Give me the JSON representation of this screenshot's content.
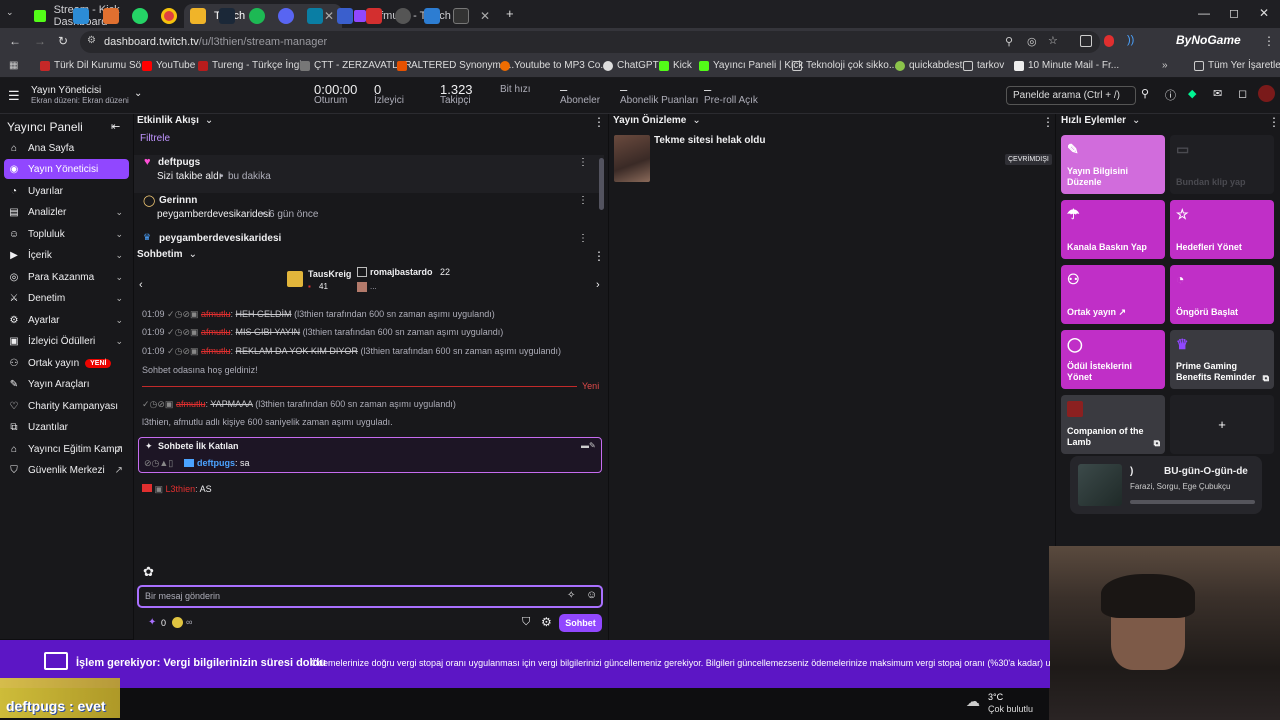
{
  "browser": {
    "tabs": [
      {
        "label": "Stream - Kick Dashboard",
        "color": "#53fc18"
      },
      {
        "label": "Twitch",
        "color": "#9147ff"
      },
      {
        "label": "afmutlu - Twitch",
        "color": "#9147ff"
      }
    ],
    "url_host": "dashboard.twitch.tv",
    "url_path": "/u/l3thien/stream-manager",
    "profile_label": "ByNoGame",
    "bookmarks": [
      "Türk Dil Kurumu Sö...",
      "YouTube",
      "Tureng - Türkçe İngi...",
      "ÇTT - ZERZAVATLAR",
      "ALTERED Synonyms...",
      "Youtube to MP3 Co...",
      "ChatGPT",
      "Kick",
      "Yayıncı Paneli | Kick",
      "Teknoloji çok sikko...",
      "quickabdest",
      "tarkov",
      "10 Minute Mail - Fr..."
    ],
    "bookmarks_all": "Tüm Yer İşaretleri"
  },
  "topbar": {
    "manager_title": "Yayın Yöneticisi",
    "layout_label": "Ekran düzeni: Ekran düzeni 1",
    "stats": [
      {
        "value": "0:00:00",
        "label": "Oturum"
      },
      {
        "value": "0",
        "label": "İzleyici"
      },
      {
        "value": "1.323",
        "label": "Takipçi"
      },
      {
        "value": "",
        "label": "Bit hızı"
      },
      {
        "value": "–",
        "label": "Aboneler"
      },
      {
        "value": "–",
        "label": "Abonelik Puanları"
      },
      {
        "value": "–",
        "label": "Pre-roll Açık"
      }
    ],
    "search_placeholder": "Panelde arama (Ctrl + /)"
  },
  "sidebar": {
    "title": "Yayıncı Paneli",
    "items": [
      {
        "label": "Ana Sayfa",
        "icon": "house-icon",
        "chevron": false
      },
      {
        "label": "Yayın Yöneticisi",
        "icon": "broadcast-icon",
        "chevron": false,
        "active": true
      },
      {
        "label": "Uyarılar",
        "icon": "bell-icon",
        "chevron": false
      },
      {
        "label": "Analizler",
        "icon": "chart-icon",
        "chevron": true
      },
      {
        "label": "Topluluk",
        "icon": "people-icon",
        "chevron": true
      },
      {
        "label": "İçerik",
        "icon": "video-icon",
        "chevron": true
      },
      {
        "label": "Para Kazanma",
        "icon": "coin-icon",
        "chevron": true
      },
      {
        "label": "Denetim",
        "icon": "sword-icon",
        "chevron": true
      },
      {
        "label": "Ayarlar",
        "icon": "gear-icon",
        "chevron": true
      },
      {
        "label": "İzleyici Ödülleri",
        "icon": "gift-icon",
        "chevron": true
      },
      {
        "label": "Ortak yayın",
        "icon": "coop-icon",
        "badge": "YENİ"
      },
      {
        "label": "Yayın Araçları",
        "icon": "tools-icon"
      },
      {
        "label": "Charity Kampanyası",
        "icon": "charity-icon"
      },
      {
        "label": "Uzantılar",
        "icon": "extension-icon"
      },
      {
        "label": "Yayıncı Eğitim Kampı",
        "icon": "campus-icon",
        "external": true
      },
      {
        "label": "Güvenlik Merkezi",
        "icon": "shield-icon",
        "external": true
      }
    ]
  },
  "activity": {
    "title": "Etkinlik Akışı",
    "filter": "Filtrele",
    "items": [
      {
        "user": "deftpugs",
        "desc": "Sizi takibe aldı",
        "time": "bu dakika",
        "icon": "heart-icon"
      },
      {
        "user": "Gerinnn",
        "desc": "peygamberdevesikaridesi",
        "time": "6 gün önce",
        "icon": "raid-icon"
      },
      {
        "user": "peygamberdevesikaridesi",
        "desc": "",
        "time": "",
        "icon": "crown-icon"
      }
    ]
  },
  "chat": {
    "title": "Sohbetim",
    "gifter1": {
      "name": "TausKreig",
      "count": "41"
    },
    "gifter2": {
      "name": "romajbastardo",
      "count": "22"
    },
    "lines": [
      {
        "time": "01:09",
        "user": "afmutlu",
        "msg": "HEH GELDİM",
        "note": "(l3thien tarafından 600 sn zaman aşımı uygulandı)"
      },
      {
        "time": "01:09",
        "user": "afmutlu",
        "msg": "MIS GIBI YAYIN",
        "note": "(l3thien tarafından 600 sn zaman aşımı uygulandı)"
      },
      {
        "time": "01:09",
        "user": "afmutlu",
        "msg": "REKLAM DA YOK KIM DIYOR",
        "note": "(l3thien tarafından 600 sn zaman aşımı uygulandı)"
      }
    ],
    "welcome": "Sohbet odasına hoş geldiniz!",
    "new_label": "Yeni",
    "line4": {
      "user": "afmutlu",
      "msg": "YAPMAAA",
      "note": "(l3thien tarafından 600 sn zaman aşımı uygulandı)"
    },
    "timeout_notice": "l3thien, afmutlu adlı kişiye 600 saniyelik zaman aşımı uyguladı.",
    "first_chat_title": "Sohbete İlk Katılan",
    "first_chat_user": "deftpugs",
    "first_chat_msg": "sa",
    "owner_user": "L3thien",
    "owner_msg": "AS",
    "input_placeholder": "Bir mesaj gönderin",
    "points": "0",
    "send_label": "Sohbet"
  },
  "preview": {
    "title": "Yayın Önizleme",
    "stream_title": "Tekme sitesi helak oldu",
    "status": "ÇEVRİMDIŞI"
  },
  "quick": {
    "title": "Hızlı Eylemler",
    "tiles": [
      {
        "label": "Yayın Bilgisini Düzenle",
        "icon": "pencil-icon"
      },
      {
        "label": "Bundan klip yap",
        "icon": "clip-icon",
        "disabled": true
      },
      {
        "label": "Kanala Baskın Yap",
        "icon": "raid-icon"
      },
      {
        "label": "Hedefleri Yönet",
        "icon": "star-icon"
      },
      {
        "label": "Ortak yayın ↗",
        "icon": "coop-icon"
      },
      {
        "label": "Öngörü Başlat",
        "icon": "prediction-icon"
      },
      {
        "label": "Ödül İsteklerini Yönet",
        "icon": "reward-icon"
      },
      {
        "label": "Prime Gaming Benefits Reminder",
        "icon": "crown-icon",
        "gray": true
      },
      {
        "label": "Companion of the Lamb",
        "icon": "lamb-icon",
        "gray": true
      }
    ],
    "add_label": "+"
  },
  "nowplaying": {
    "title": "BU-gün-O-gün-de",
    "artist": "Farazi, Sorgu, Ege Çubukçu"
  },
  "banner": {
    "title": "İşlem gerekiyor: Vergi bilgilerinizin süresi doldu",
    "body": "Ödemelerinize doğru vergi stopaj oranı uygulanması için vergi bilgilerinizi güncellemeniz gerekiyor. Bilgileri güncellemezseniz ödemelerinize maksimum vergi stopaj oranı (%30'a kadar) uyg"
  },
  "overlay": {
    "alert": "deftpugs : evet"
  },
  "taskbar": {
    "weather_temp": "3°C",
    "weather_desc": "Çok bulutlu"
  }
}
